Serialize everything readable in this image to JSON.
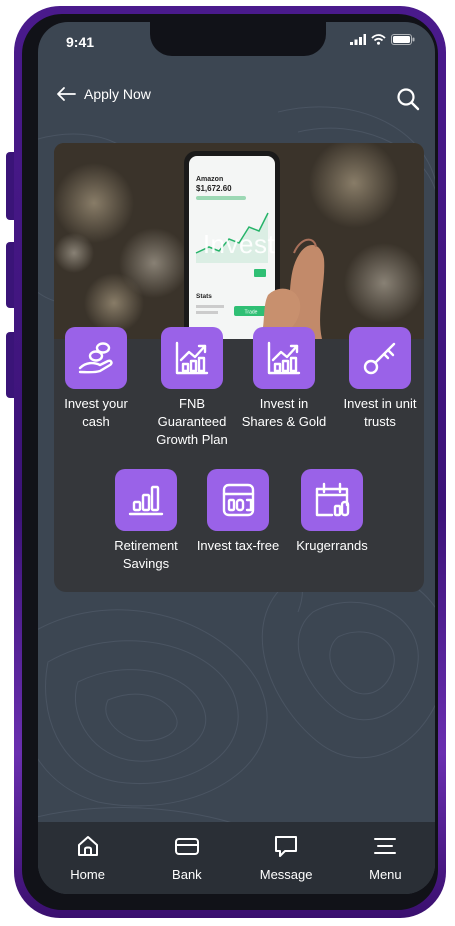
{
  "status_bar": {
    "time": "9:41"
  },
  "header": {
    "back_label": "Apply Now"
  },
  "banner": {
    "title": "Invest",
    "phone_stock": "Amazon",
    "phone_price": "$1,672.60",
    "phone_section": "Stats",
    "phone_button": "Trade"
  },
  "tiles": [
    {
      "label": "Invest your cash",
      "icon": "hand-coins-icon"
    },
    {
      "label": "FNB Guaranteed Growth Plan",
      "icon": "growth-chart-icon"
    },
    {
      "label": "Invest in Shares & Gold",
      "icon": "shares-chart-icon"
    },
    {
      "label": "Invest in unit trusts",
      "icon": "key-icon"
    },
    {
      "label": "Retirement Savings",
      "icon": "bar-chart-icon"
    },
    {
      "label": "Invest tax-free",
      "icon": "wallet-icon"
    },
    {
      "label": "Krugerrands",
      "icon": "calendar-chart-icon"
    }
  ],
  "nav": [
    {
      "label": "Home",
      "icon": "home-icon"
    },
    {
      "label": "Bank",
      "icon": "card-icon"
    },
    {
      "label": "Message",
      "icon": "message-icon"
    },
    {
      "label": "Menu",
      "icon": "menu-icon"
    }
  ],
  "colors": {
    "accent_purple": "#9a62e8",
    "frame_purple": "#4a1a8c",
    "screen_background": "#3c4652",
    "card_background": "#35373b",
    "nav_background": "#2a2f36"
  }
}
